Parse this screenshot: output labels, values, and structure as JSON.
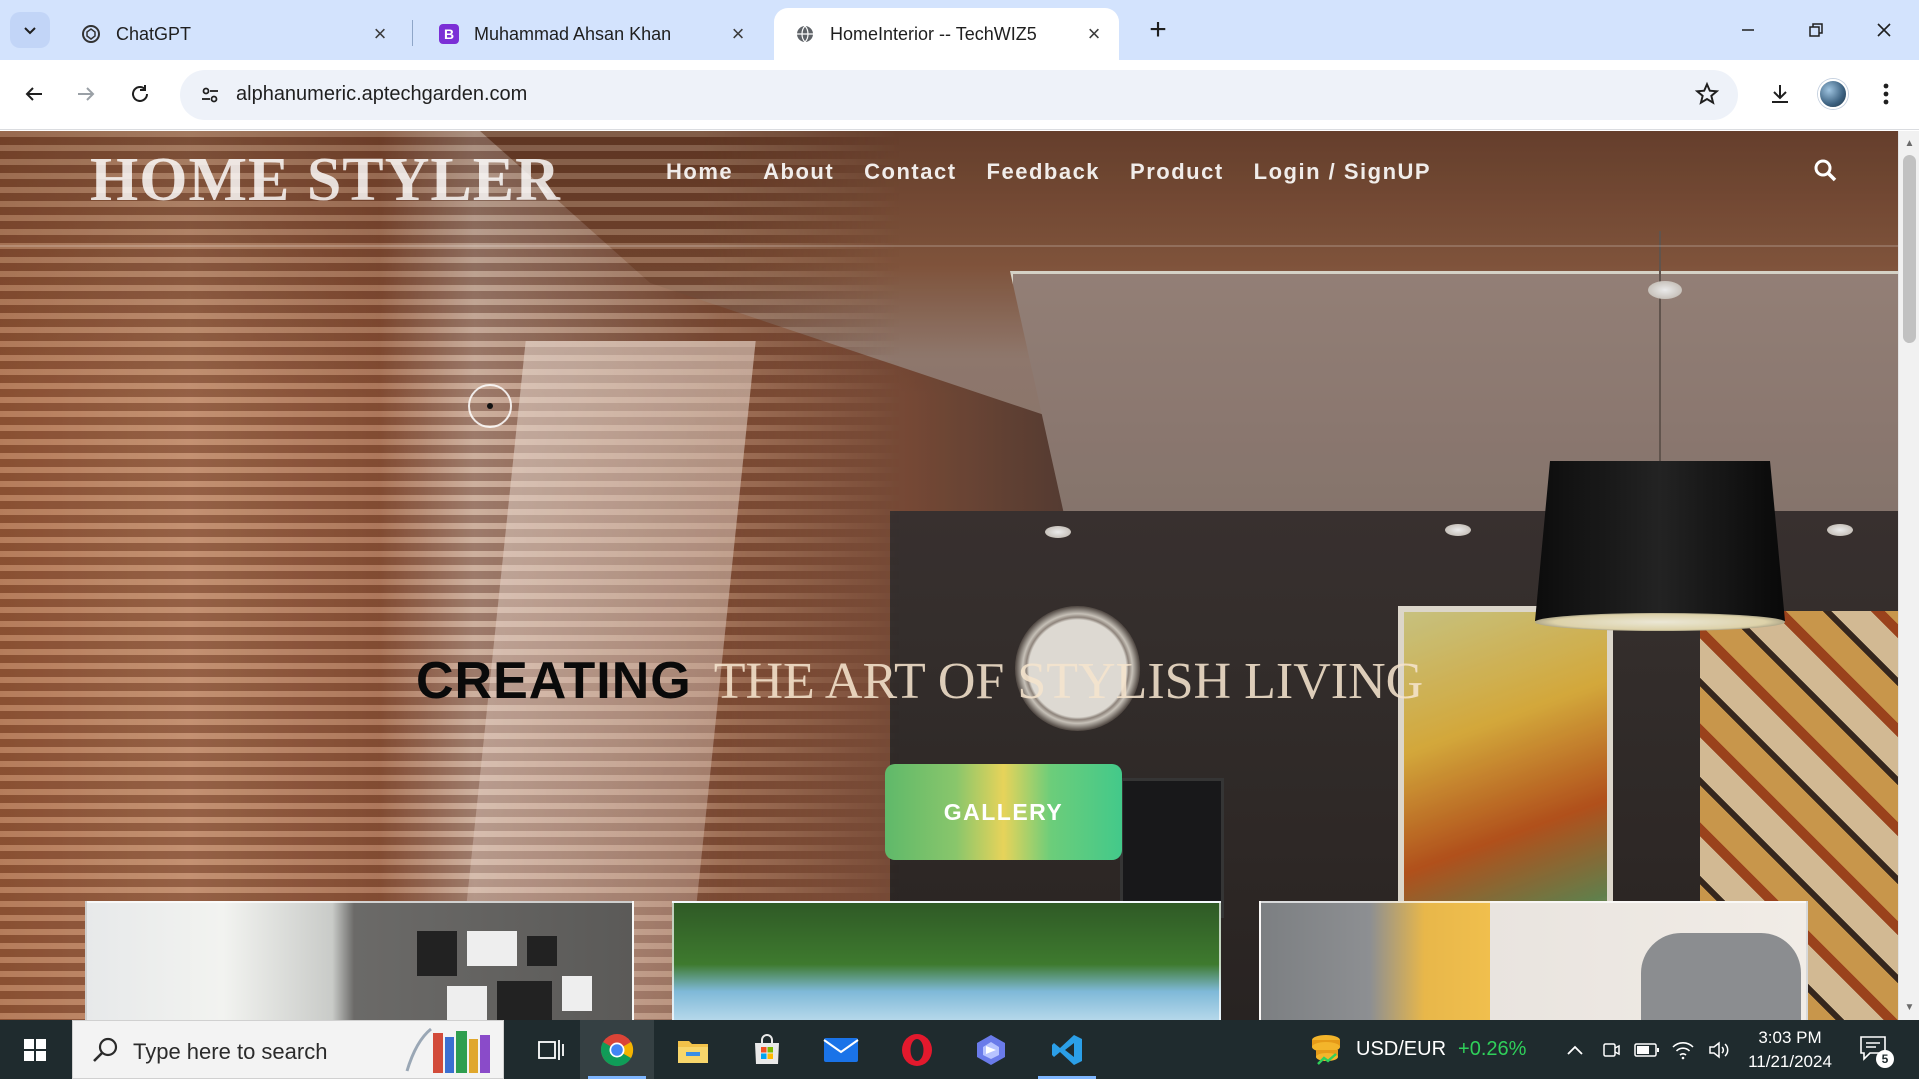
{
  "browser": {
    "tabs": [
      {
        "title": "ChatGPT",
        "icon": "chatgpt-icon"
      },
      {
        "title": "Muhammad Ahsan Khan",
        "icon": "bootstrap-icon"
      },
      {
        "title": "HomeInterior -- TechWIZ5",
        "icon": "globe-icon"
      }
    ],
    "active_tab": 2,
    "url": "alphanumeric.aptechgarden.com"
  },
  "site": {
    "logo": "HOME STYLER",
    "nav": [
      "Home",
      "About",
      "Contact",
      "Feedback",
      "Product",
      "Login / SignUP"
    ],
    "headline_strong": "CREATING",
    "headline_rest": "THE ART OF STYLISH LIVING",
    "gallery_button": "GALLERY"
  },
  "taskbar": {
    "search_placeholder": "Type here to search",
    "apps": [
      "task-view-icon",
      "chrome-icon",
      "file-explorer-icon",
      "microsoft-store-icon",
      "mail-icon",
      "opera-icon",
      "copilot-icon",
      "vscode-icon"
    ],
    "active_app": "chrome-icon",
    "forex_pair": "USD/EUR",
    "forex_change": "+0.26%",
    "time": "3:03 PM",
    "date": "11/21/2024",
    "notifications": "5"
  },
  "colors": {
    "tabstrip": "#d3e3fd",
    "taskbar": "#1f2b2e",
    "forex_up": "#2fd05a",
    "gallery_gradient": [
      "#5fb96a",
      "#e7d35a",
      "#43c98a"
    ]
  }
}
